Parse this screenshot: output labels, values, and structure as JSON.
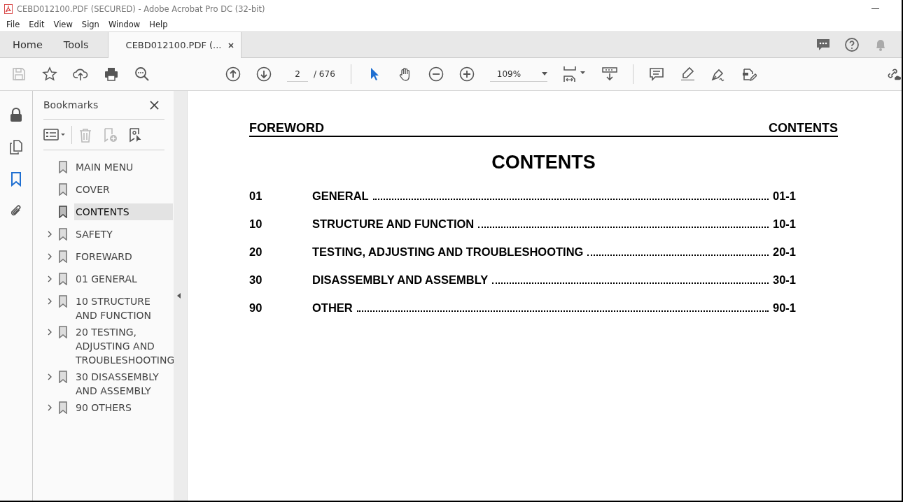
{
  "window": {
    "title": "CEBD012100.PDF (SECURED) - Adobe Acrobat Pro DC (32-bit)"
  },
  "menu": [
    "File",
    "Edit",
    "View",
    "Sign",
    "Window",
    "Help"
  ],
  "tabs": [
    {
      "label": "Home",
      "selected": false
    },
    {
      "label": "Tools",
      "selected": false
    },
    {
      "label": "CEBD012100.PDF (...",
      "selected": true,
      "closable": true
    }
  ],
  "toolbar": {
    "page": "2",
    "page_total": "/ 676",
    "zoom": "109%"
  },
  "bookmarks": {
    "title": "Bookmarks",
    "items": [
      {
        "label": "MAIN MENU",
        "expandable": false,
        "selected": false
      },
      {
        "label": "COVER",
        "expandable": false,
        "selected": false
      },
      {
        "label": "CONTENTS",
        "expandable": false,
        "selected": true
      },
      {
        "label": "SAFETY",
        "expandable": true,
        "selected": false
      },
      {
        "label": "FOREWARD",
        "expandable": true,
        "selected": false
      },
      {
        "label": "01 GENERAL",
        "expandable": true,
        "selected": false
      },
      {
        "label": "10 STRUCTURE AND FUNCTION",
        "expandable": true,
        "selected": false
      },
      {
        "label": "20 TESTING, ADJUSTING AND TROUBLESHOOTING",
        "expandable": true,
        "selected": false
      },
      {
        "label": "30 DISASSEMBLY AND ASSEMBLY",
        "expandable": true,
        "selected": false
      },
      {
        "label": "90 OTHERS",
        "expandable": true,
        "selected": false
      }
    ]
  },
  "document": {
    "header_left": "FOREWORD",
    "header_right": "CONTENTS",
    "heading": "CONTENTS",
    "rows": [
      {
        "number": "01",
        "title": "GENERAL",
        "page": "01-1"
      },
      {
        "number": "10",
        "title": "STRUCTURE AND FUNCTION",
        "page": "10-1"
      },
      {
        "number": "20",
        "title": "TESTING, ADJUSTING AND TROUBLESHOOTING",
        "page": "20-1"
      },
      {
        "number": "30",
        "title": "DISASSEMBLY AND ASSEMBLY",
        "page": "30-1"
      },
      {
        "number": "90",
        "title": "OTHER",
        "page": "90-1"
      }
    ]
  }
}
